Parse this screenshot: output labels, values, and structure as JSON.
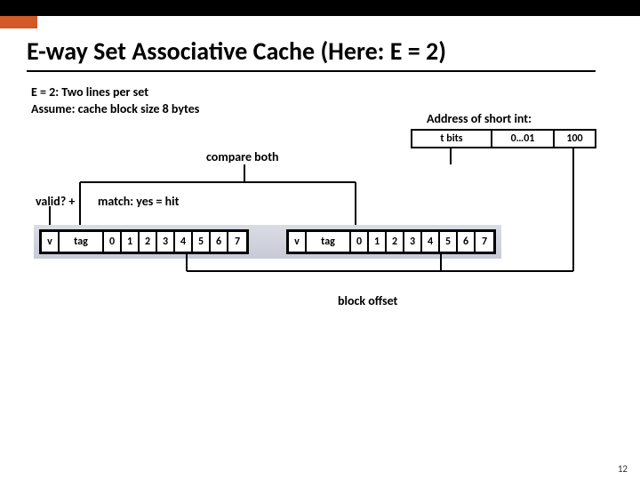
{
  "slide": {
    "title": "E-way Set Associative Cache (Here: E = 2)",
    "subtitle_l1": "E = 2: Two lines per set",
    "subtitle_l2": "Assume: cache block size 8 bytes",
    "address_heading": "Address of short int:",
    "address_fields": {
      "tag": "t bits",
      "set": "0…01",
      "offset": "100"
    },
    "compare_label": "compare both",
    "valid_label": "valid?  +",
    "match_label": "match: yes = hit",
    "bytes": [
      "0",
      "1",
      "2",
      "3",
      "4",
      "5",
      "6",
      "7"
    ],
    "line_labels": {
      "v": "v",
      "tag": "tag"
    },
    "block_offset_label": "block offset",
    "page_number": "12"
  }
}
